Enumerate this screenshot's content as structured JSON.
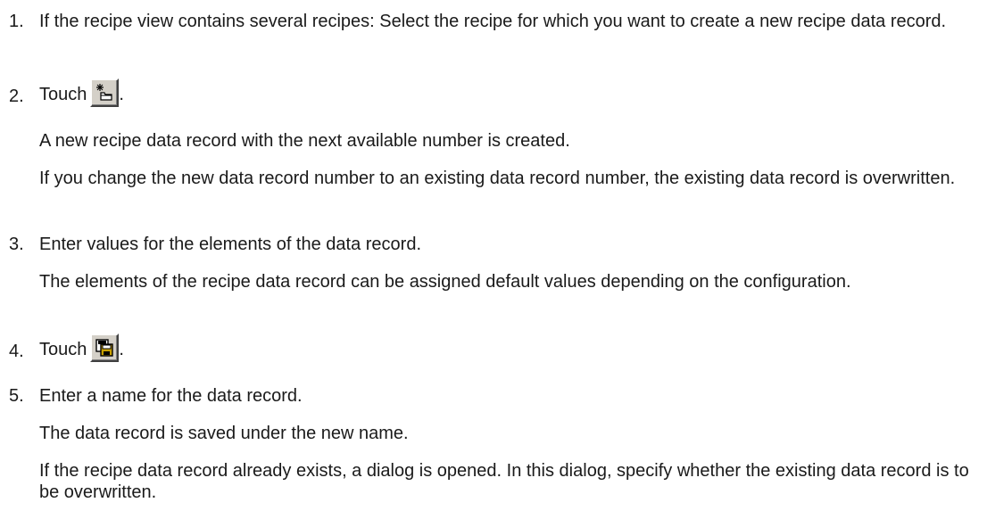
{
  "steps": [
    {
      "number": "1.",
      "text": "If the recipe view contains several recipes: Select the recipe for which you want to create a new recipe data record."
    },
    {
      "number": "2.",
      "lead": "Touch",
      "icon": "new-record-icon",
      "trail": ".",
      "paragraphs": [
        "A new recipe data record with the next available number is created.",
        "If you change the new data record number to an existing data record number, the existing data record is overwritten."
      ]
    },
    {
      "number": "3.",
      "text": "Enter values for the elements of the data record.",
      "paragraphs": [
        "The elements of the recipe data record can be assigned default values depending on the configuration."
      ]
    },
    {
      "number": "4.",
      "lead": "Touch",
      "icon": "save-record-icon",
      "trail": "."
    },
    {
      "number": "5.",
      "text": "Enter a name for the data record.",
      "paragraphs": [
        "The data record is saved under the new name.",
        "If the recipe data record already exists, a dialog is opened. In this dialog, specify whether the existing data record is to be overwritten."
      ]
    }
  ],
  "colors": {
    "text": "#1a1a1a",
    "button_face": "#d4d0c8",
    "icon_accent": "#c8a000"
  }
}
